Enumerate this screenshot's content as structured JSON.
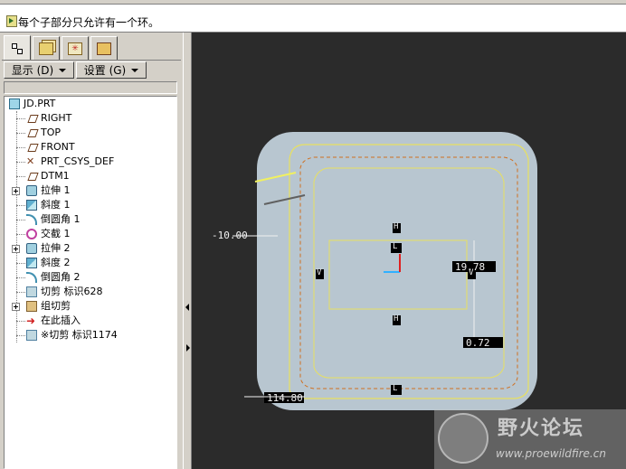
{
  "message": {
    "icon": "info-icon",
    "text": "每个子部分只允许有一个环。"
  },
  "tabs": [
    {
      "icon": "model-tree-icon",
      "active": true
    },
    {
      "icon": "layers-icon",
      "active": false
    },
    {
      "icon": "favorites-icon",
      "active": false
    },
    {
      "icon": "connections-icon",
      "active": false
    }
  ],
  "toolbar": {
    "show_label": "显示 (D)",
    "settings_label": "设置 (G)"
  },
  "tree": {
    "root": "JD.PRT",
    "items": [
      {
        "label": "RIGHT",
        "icon": "datum-plane-icon"
      },
      {
        "label": "TOP",
        "icon": "datum-plane-icon"
      },
      {
        "label": "FRONT",
        "icon": "datum-plane-icon"
      },
      {
        "label": "PRT_CSYS_DEF",
        "icon": "csys-icon"
      },
      {
        "label": "DTM1",
        "icon": "datum-plane-icon"
      },
      {
        "label": "拉伸 1",
        "icon": "extrude-icon",
        "expandable": true
      },
      {
        "label": "斜度 1",
        "icon": "draft-icon"
      },
      {
        "label": "倒圆角 1",
        "icon": "round-icon"
      },
      {
        "label": "交截 1",
        "icon": "intersect-icon"
      },
      {
        "label": "拉伸 2",
        "icon": "extrude-icon",
        "expandable": true
      },
      {
        "label": "斜度 2",
        "icon": "draft-icon"
      },
      {
        "label": "倒圆角 2",
        "icon": "round-icon"
      },
      {
        "label": "切剪 标识628",
        "icon": "cut-icon"
      },
      {
        "label": "组切剪",
        "icon": "group-icon",
        "expandable": true
      },
      {
        "label": "在此插入",
        "icon": "insert-here-icon"
      },
      {
        "label": "※切剪 标识1174",
        "icon": "cut-icon"
      }
    ]
  },
  "viewport": {
    "dimensions": {
      "offset": "-10.00",
      "right_top": "19.78",
      "right_bottom": "0.72",
      "bottom": "114.80"
    },
    "labels": {
      "h": "H",
      "v": "V",
      "l": "L"
    }
  },
  "watermark": {
    "title": "野火论坛",
    "url": "www.proewildfire.cn"
  }
}
